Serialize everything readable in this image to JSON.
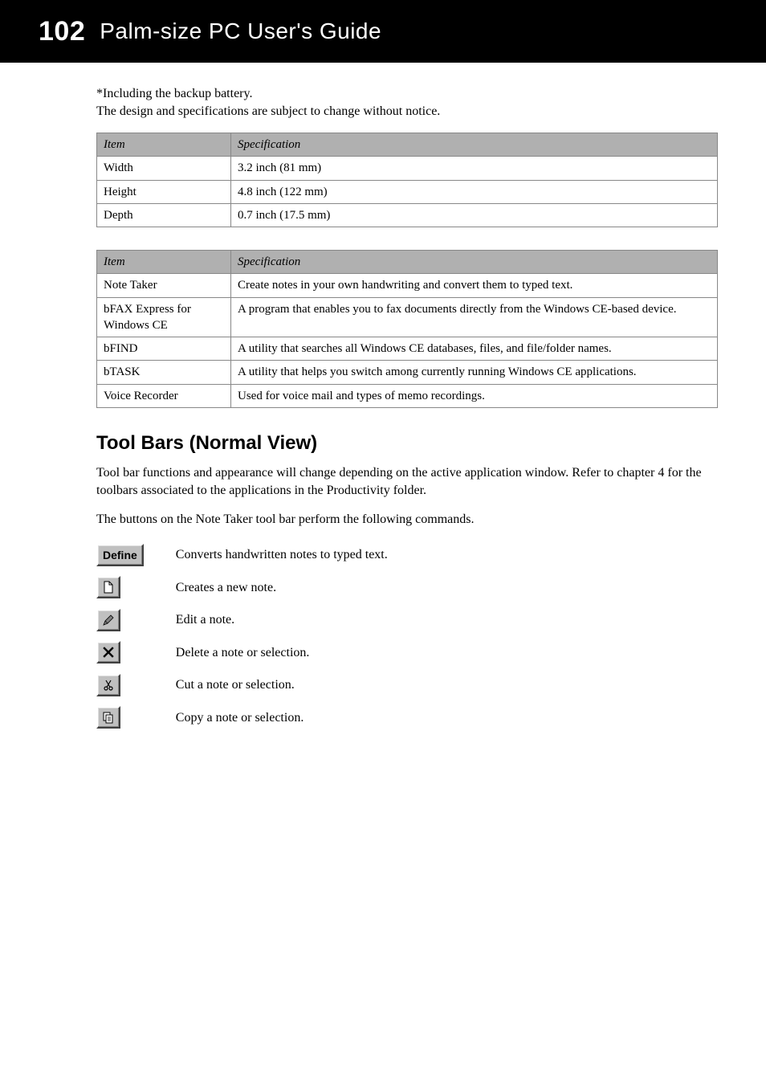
{
  "header": {
    "page_number": "102",
    "doc_title": "Palm-size PC User's Guide"
  },
  "intro": {
    "line1": "*Including the backup battery.",
    "line2": "The design and specifications are subject to change without notice."
  },
  "table1": {
    "headers": [
      "Item",
      "Specification"
    ],
    "rows": [
      [
        "Width",
        "3.2 inch  (81 mm)"
      ],
      [
        "Height",
        "4.8 inch  (122 mm)"
      ],
      [
        "Depth",
        "0.7 inch  (17.5 mm)"
      ]
    ]
  },
  "table2": {
    "headers": [
      "Item",
      "Specification"
    ],
    "rows": [
      [
        "Note Taker",
        "Create notes in your own handwriting and convert them to typed text."
      ],
      [
        "bFAX Express for Windows CE",
        "A program that enables you to fax documents directly from the Windows CE-based device."
      ],
      [
        "bFIND",
        "A utility that searches all Windows CE databases, files, and file/folder names."
      ],
      [
        "bTASK",
        "A utility that helps you switch among currently running Windows CE applications."
      ],
      [
        "Voice Recorder",
        "Used for voice mail and types of memo recordings."
      ]
    ]
  },
  "toolbar_section": {
    "title": "Tool Bars (Normal View)",
    "para1": "Tool bar functions and appearance will change depending on the active application window. Refer to chapter 4 for the toolbars associated to the applications in the Productivity folder.",
    "para2": "The buttons on the Note Taker tool bar perform the following commands.",
    "commands": [
      {
        "icon": "define-button",
        "label": "Define",
        "desc": "Converts handwritten notes to typed text."
      },
      {
        "icon": "new-icon",
        "desc": "Creates a new note."
      },
      {
        "icon": "edit-icon",
        "desc": "Edit a note."
      },
      {
        "icon": "delete-icon",
        "desc": "Delete a note or selection."
      },
      {
        "icon": "cut-icon",
        "desc": "Cut a note or selection."
      },
      {
        "icon": "copy-icon",
        "desc": "Copy a note or selection."
      }
    ]
  }
}
